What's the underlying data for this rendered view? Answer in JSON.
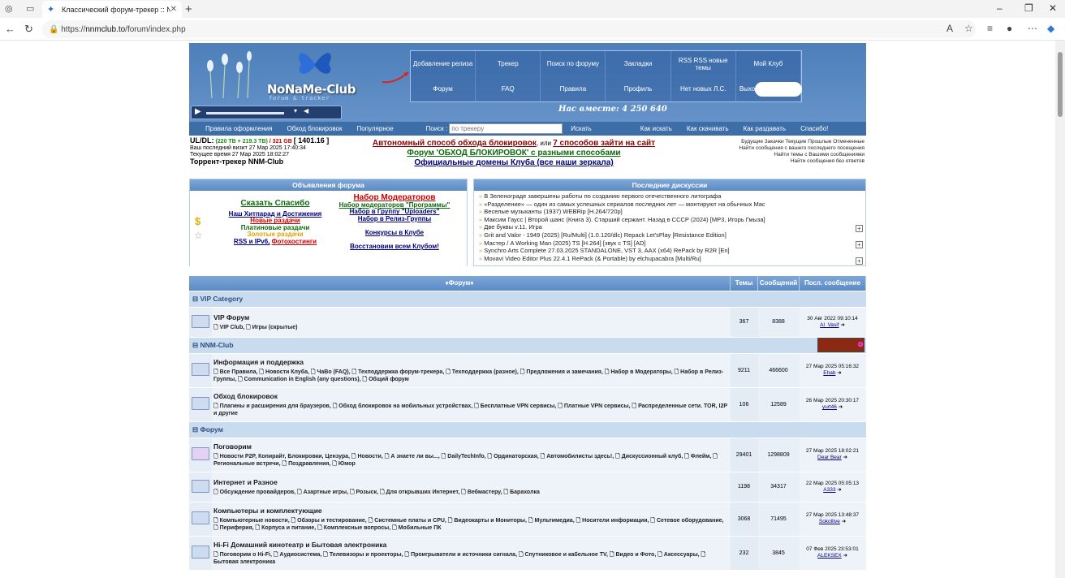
{
  "browser": {
    "tab_title": "Классический форум-трекер :: N",
    "url_prefix": "https://",
    "url_domain": "nnmclub.to",
    "url_path": "/forum/index.php"
  },
  "banner": {
    "logo": "NoNaMe-Club",
    "logo_sub": "forum & tracker",
    "together": "Нас вместе: 4 250 640",
    "menu": [
      "Добавление релиза",
      "Трекер",
      "Поиск по форуму",
      "Закладки",
      "RSS RSS новые темы",
      "Мой Клуб",
      "Форум",
      "FAQ",
      "Правила",
      "Профиль",
      "Нет новых Л.С.",
      "Выход"
    ]
  },
  "subnav": {
    "items": [
      "Правила оформления",
      "Обход блокировок",
      "Популярное"
    ],
    "search_label": "Поиск :",
    "search_placeholder": "по трекеру",
    "search_btn": "Искать",
    "links": [
      "Как искать",
      "Как скачивать",
      "Как раздавать",
      "Спасибо!"
    ]
  },
  "stats": {
    "l1a": "UL/DL:",
    "l1b": "(220 ТВ + 219.3 ТВ)",
    "l1c": "/ 321 GB",
    "l1d": "[ 1401.16 ]",
    "l2": "Ваш последний визит 27 Мар 2025 17:40:34",
    "l3": "Текущее время 27 Мар 2025 18:02:27",
    "l4": "Торрент-трекер NNM-Club"
  },
  "center": {
    "a": "Автономный способ обхода блокировок",
    "or": ", или ",
    "b": "7 способов зайти на сайт",
    "c": "Форум 'ОБХОД БЛОКИРОВОК' с разными способами",
    "d": "Официальные домены Клуба (все наши зеркала)"
  },
  "rightinfo": [
    "Будущие Закачки Текущие Прошлые Отмененные",
    "Найти сообщения с вашего последнего посещения",
    "Найти темы с Вашими сообщениями",
    "Найти сообщения без ответов"
  ],
  "ann": {
    "title": "Объявления форума",
    "l": [
      "Сказать Спасибо",
      "Наш Хитпарад и Достижения",
      "Новые раздачи",
      "Платиновые раздачи",
      "Золотые раздачи",
      "RSS и IPv6,",
      "Фотохостинги"
    ],
    "r": [
      "Набор Модераторов",
      "Набор модераторов \"Программы\"",
      "Набор в Группу \"Uploaders\"",
      "Набор в Релиз-Группы",
      "Конкурсы в Клубе",
      "Восстановим всем Клубом!"
    ]
  },
  "disc": {
    "title": "Последние дискуссии",
    "items": [
      "В Зеленограде завершены работы по созданию первого отечественного литографа",
      "«Разделение» — один из самых успешных сериалов последних лет — монтируют на обычных Mac",
      "Веселые музыканты (1937) WEBRip [H.264/720p]",
      "Максим Гаусс | Второй шанс (Книга 3). Старший сержант. Назад в СССР (2024) [MP3, Игорь Гмыза]",
      "Две буквы v.11. Игра",
      "Grit and Valor - 1949 (2025) [Ru/Multi] (1.0.120/dlc) Repack Let'sPlay [Resistance Edition]",
      "Мастер / A Working Man (2025) TS [H.264] [звук с TS] [AD]",
      "Synchro Arts Complete 27.03.2025 STANDALONE, VST 3, AAX (x64) RePack by R2R [En]",
      "Movavi Video Editor Plus 22.4.1 RePack (& Portable) by elchupacabra [Multi/Ru]"
    ]
  },
  "forum": {
    "h": [
      "♦Форум♦",
      "Темы",
      "Сообщений",
      "Посл. сообщение"
    ],
    "c1": "⊟ VIP Category",
    "c2": "⊟ NNM-Club",
    "c3": "⊟ Форум",
    "r": [
      {
        "n": "VIP Форум",
        "s": "🗋 VIP Club, 🗋 Игры (скрытые)",
        "t": "367",
        "p": "8388",
        "d": "30 Авг 2022 09:10:14",
        "u": "Al_Vasif"
      },
      {
        "n": "Информация и поддержка",
        "s": "🗋 Все Правила, 🗋 Новости Клуба, 🗋 ЧаВо (FAQ), 🗋 Техподдержка форум-трекера, 🗋 Техподдержка (разное), 🗋 Предложения и замечания, 🗋 Набор в Модераторы, 🗋 Набор в Релиз-Группы, 🗋 Communication in English (any questions), 🗋 Общий форум",
        "t": "9211",
        "p": "466600",
        "d": "27 Мар 2025 05:16:32",
        "u": "Ehab"
      },
      {
        "n": "Обход блокировок",
        "s": "🗋 Плагины и расширения для браузеров, 🗋 Обход блокировок на мобильных устройствах, 🗋 Бесплатные VPN сервисы, 🗋 Платные VPN сервисы, 🗋 Распределенные сети. TOR, I2P и другие",
        "t": "106",
        "p": "12589",
        "d": "26 Мар 2025 20:30:17",
        "u": "yurt46"
      },
      {
        "n": "Поговорим",
        "s": "🗋 Новости P2P, Копирайт, Блокировки, Цензура, 🗋 Новости, 🗋 А знаете ли вы..., 🗋 DailyTechInfo, 🗋 Ординаторская, 🗋 Автомобилисты здесь!, 🗋 Дискуссионный клуб, 🗋 Флейм, 🗋 Региональные встречи, 🗋 Поздравления, 🗋 Юмор",
        "t": "29401",
        "p": "1298809",
        "d": "27 Мар 2025 18:02:21",
        "u": "Dear Bear"
      },
      {
        "n": "Интернет и Разное",
        "s": "🗋 Обсуждение провайдеров, 🗋 Азартные игры, 🗋 Розыск, 🗋 Для открывших Интернет, 🗋 Вебмастеру, 🗋 Барахолка",
        "t": "1198",
        "p": "34317",
        "d": "22 Мар 2025 05:05:13",
        "u": "A333"
      },
      {
        "n": "Компьютеры и комплектующие",
        "s": "🗋 Компьютерные новости, 🗋 Обзоры и тестирование, 🗋 Системные платы и CPU, 🗋 Видеокарты и Мониторы, 🗋 Мультимедиа, 🗋 Носители информации, 🗋 Сетевое оборудование, 🗋 Периферия, 🗋 Корпуса и питание, 🗋 Комплексные вопросы, 🗋 Мобильные ПК",
        "t": "3068",
        "p": "71495",
        "d": "27 Мар 2025 13:48:37",
        "u": "Sokollive"
      },
      {
        "n": "Hi-Fi Домашний кинотеатр и Бытовая электроника",
        "s": "🗋 Поговорим о Hi-Fi, 🗋 Аудиосистема, 🗋 Телевизоры и проекторы, 🗋 Проигрыватели и источники сигнала, 🗋 Спутниковое и кабельное TV, 🗋 Видео и Фото, 🗋 Аксессуары, 🗋 Бытовая электроника",
        "t": "232",
        "p": "3845",
        "d": "07 Фев 2025 23:53:01",
        "u": "ALEKSEX"
      }
    ]
  }
}
